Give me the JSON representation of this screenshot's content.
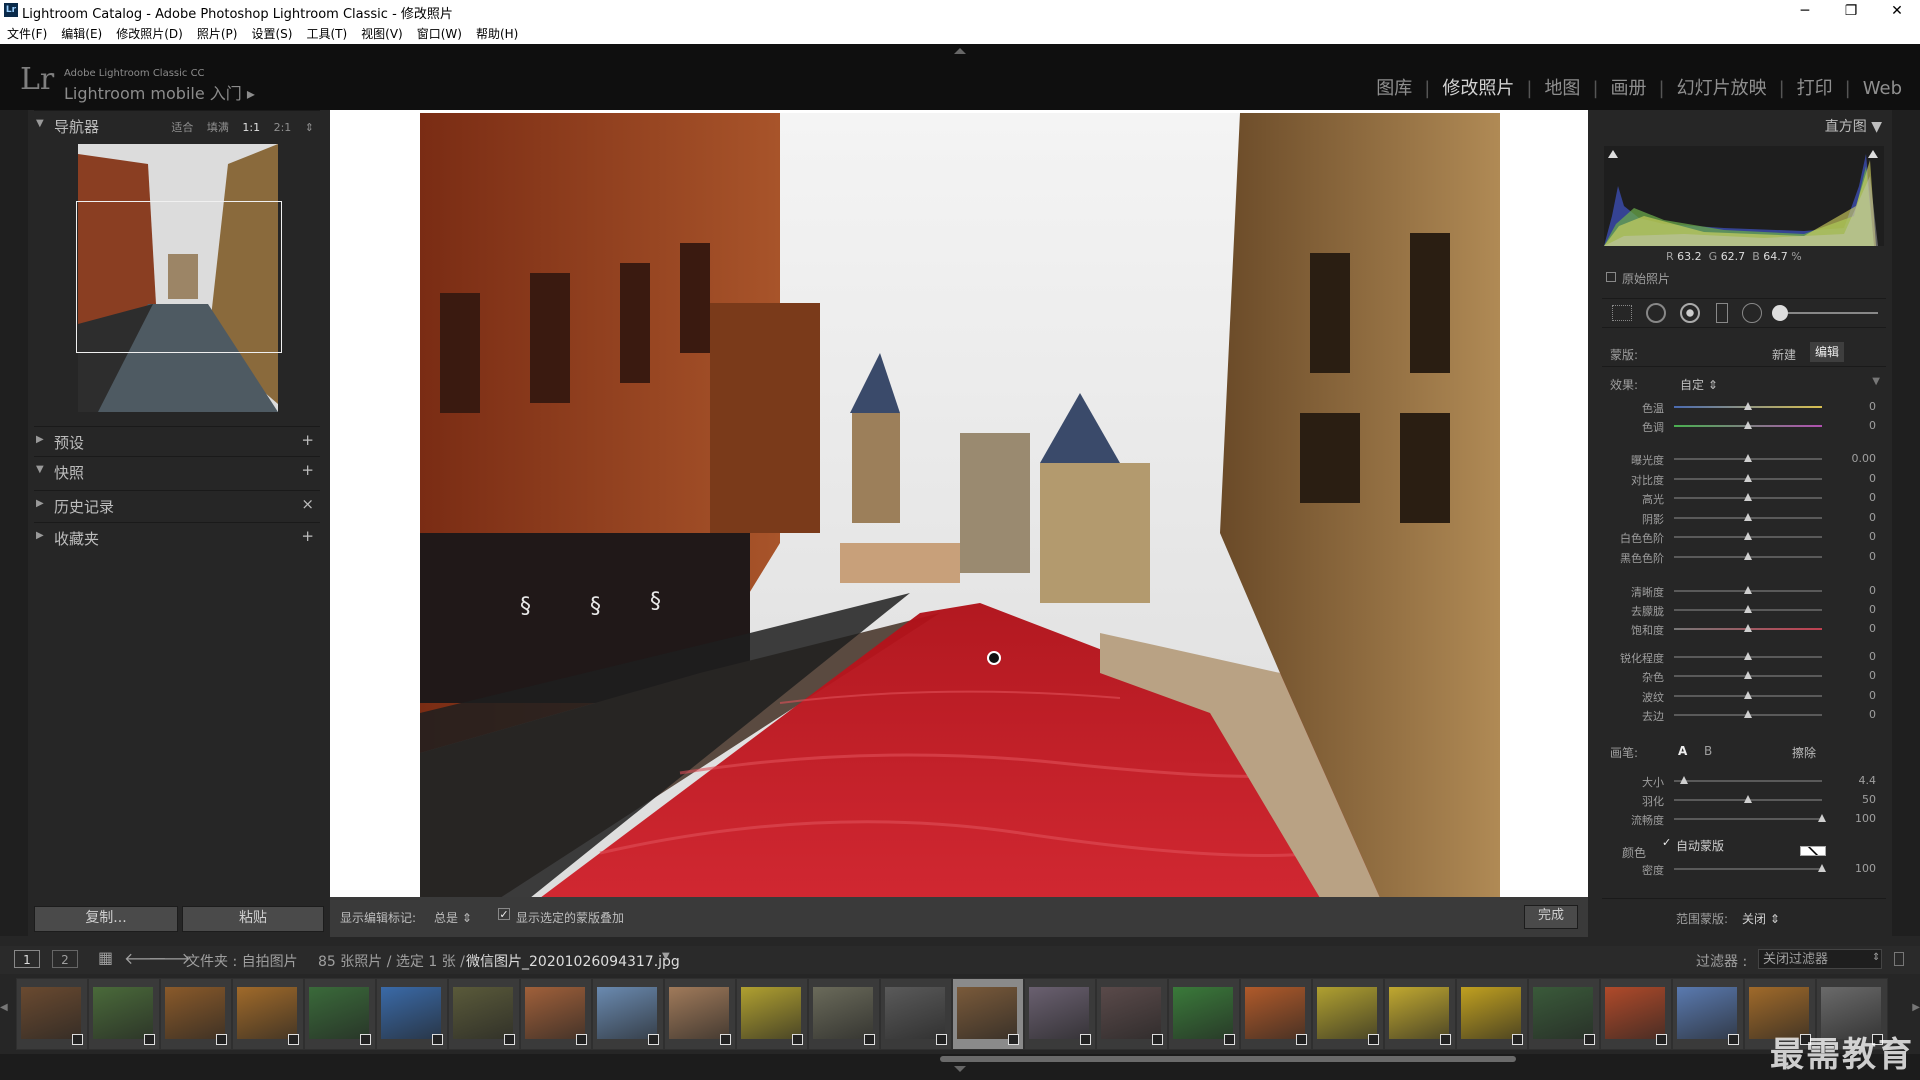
{
  "window": {
    "title": "Lightroom Catalog - Adobe Photoshop Lightroom Classic - 修改照片",
    "app_icon": "Lr",
    "controls": [
      "─",
      "❐",
      "✕"
    ]
  },
  "menu": [
    "文件(F)",
    "编辑(E)",
    "修改照片(D)",
    "照片(P)",
    "设置(S)",
    "工具(T)",
    "视图(V)",
    "窗口(W)",
    "帮助(H)"
  ],
  "identity": {
    "logo": "Lr",
    "line1": "Adobe Lightroom Classic CC",
    "line2": "Lightroom mobile 入门 ▸"
  },
  "modules": [
    {
      "label": "图库",
      "active": false
    },
    {
      "label": "修改照片",
      "active": true
    },
    {
      "label": "地图",
      "active": false
    },
    {
      "label": "画册",
      "active": false
    },
    {
      "label": "幻灯片放映",
      "active": false
    },
    {
      "label": "打印",
      "active": false
    },
    {
      "label": "Web",
      "active": false
    }
  ],
  "left_panel": {
    "navigator": {
      "title": "导航器",
      "options": [
        "适合",
        "填满",
        "1:1",
        "2:1"
      ],
      "selected": "1:1"
    },
    "sections": [
      {
        "title": "预设",
        "expanded": false,
        "action": "+"
      },
      {
        "title": "快照",
        "expanded": true,
        "action": "+"
      },
      {
        "title": "历史记录",
        "expanded": false,
        "action": "×"
      },
      {
        "title": "收藏夹",
        "expanded": false,
        "action": "+"
      }
    ],
    "copy_button": "复制...",
    "paste_button": "粘贴"
  },
  "toolbar": {
    "show_edit_pins_label": "显示编辑标记:",
    "show_edit_pins_value": "总是",
    "overlay_checkbox_label": "显示选定的蒙版叠加",
    "overlay_checked": true,
    "done_button": "完成"
  },
  "right_panel": {
    "histogram": {
      "title": "直方图",
      "r_label": "R",
      "r": "63.2",
      "g_label": "G",
      "g": "62.7",
      "b_label": "B",
      "b": "64.7",
      "unit": "%",
      "original_photo_label": "原始照片"
    },
    "mask": {
      "label": "蒙版:",
      "new": "新建",
      "edit": "编辑"
    },
    "effect": {
      "label": "效果:",
      "value": "自定"
    },
    "sliders_group1": [
      {
        "label": "色温",
        "value": "0",
        "pos": 0.5
      },
      {
        "label": "色调",
        "value": "0",
        "pos": 0.5
      }
    ],
    "sliders_group2": [
      {
        "label": "曝光度",
        "value": "0.00",
        "pos": 0.5
      },
      {
        "label": "对比度",
        "value": "0",
        "pos": 0.5
      },
      {
        "label": "高光",
        "value": "0",
        "pos": 0.5
      },
      {
        "label": "阴影",
        "value": "0",
        "pos": 0.5
      },
      {
        "label": "白色色阶",
        "value": "0",
        "pos": 0.5
      },
      {
        "label": "黑色色阶",
        "value": "0",
        "pos": 0.5
      }
    ],
    "sliders_group3": [
      {
        "label": "清晰度",
        "value": "0",
        "pos": 0.5
      },
      {
        "label": "去朦胧",
        "value": "0",
        "pos": 0.5
      },
      {
        "label": "饱和度",
        "value": "0",
        "pos": 0.5
      }
    ],
    "sliders_group4": [
      {
        "label": "锐化程度",
        "value": "0",
        "pos": 0.5
      },
      {
        "label": "杂色",
        "value": "0",
        "pos": 0.5
      },
      {
        "label": "波纹",
        "value": "0",
        "pos": 0.5
      },
      {
        "label": "去边",
        "value": "0",
        "pos": 0.5
      }
    ],
    "color_label": "颜色",
    "brush": {
      "label": "画笔:",
      "a": "A",
      "b": "B",
      "erase": "擦除"
    },
    "brush_sliders": [
      {
        "label": "大小",
        "value": "4.4",
        "pos": 0.07
      },
      {
        "label": "羽化",
        "value": "50",
        "pos": 0.5
      },
      {
        "label": "流畅度",
        "value": "100",
        "pos": 1.0
      }
    ],
    "auto_mask_label": "自动蒙版",
    "auto_mask_checked": true,
    "density": {
      "label": "密度",
      "value": "100",
      "pos": 1.0
    },
    "range_mask": {
      "label": "范围蒙版:",
      "value": "关闭"
    }
  },
  "filmstrip_bar": {
    "view1": "1",
    "view2": "2",
    "path": "文件夹 : 自拍图片",
    "count": "85 张照片 / 选定 1 张 /",
    "filename": "微信图片_20201026094317.jpg",
    "filter_label": "过滤器 :",
    "filter_value": "关闭过滤器"
  },
  "filmstrip_thumbs": 26,
  "selected_thumb": 13,
  "watermark": "最需教育",
  "colors": {
    "panel_bg": "#262626",
    "mask_overlay": "#c8141e",
    "accent_text": "#bdbdbd"
  }
}
